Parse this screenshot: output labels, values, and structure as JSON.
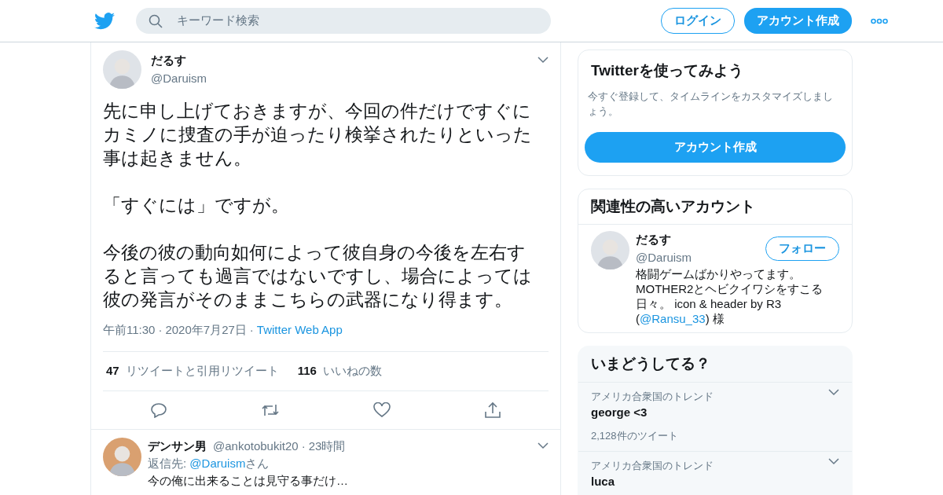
{
  "header": {
    "search": {
      "placeholder": "キーワード検索"
    },
    "login": "ログイン",
    "signup": "アカウント作成"
  },
  "tweet": {
    "name": "だるす",
    "handle": "@Daruism",
    "paragraphs": [
      "先に申し上げておきますが、今回の件だけですぐにカミノに捜査の手が迫ったり検挙されたりといった事は起きません。",
      "「すぐには」ですが。",
      "今後の彼の動向如何によって彼自身の今後を左右すると言っても過言ではないですし、場合によっては彼の発言がそのままこちらの武器になり得ます。"
    ],
    "time": "午前11:30",
    "separator": "·",
    "date": "2020年7月27日",
    "source": "Twitter Web App",
    "stats": [
      {
        "count": "47",
        "label": "リツイートと引用リツイート"
      },
      {
        "count": "116",
        "label": "いいねの数"
      }
    ]
  },
  "reply": {
    "name": "デンサン男",
    "handle": "@ankotobukit20",
    "separator": "·",
    "age": "23時間",
    "reply_prefix": "返信先: ",
    "reply_to": "@Daruism",
    "reply_suffix": "さん",
    "lines": [
      "今の俺に出来ることは見守る事だけ…"
    ]
  },
  "signup_card": {
    "title": "Twitterを使ってみよう",
    "text": "今すぐ登録して、タイムラインをカスタマイズしましょう。",
    "button": "アカウント作成"
  },
  "related": {
    "title": "関連性の高いアカウント",
    "accounts": [
      {
        "name": "だるす",
        "handle": "@Daruism",
        "follow": "フォロー",
        "bio": "格闘ゲームばかりやってます。MOTHER2とヘビクイワシをすこる日々。 icon & header by R3 (",
        "bio_link": "@Ransu_33",
        "bio_end": ") 様"
      }
    ]
  },
  "trends": {
    "title": "いまどうしてる？",
    "items": [
      {
        "context": "アメリカ合衆国のトレンド",
        "topic": "george <3",
        "count": "2,128件のツイート"
      },
      {
        "context": "アメリカ合衆国のトレンド",
        "topic": "luca"
      }
    ]
  }
}
